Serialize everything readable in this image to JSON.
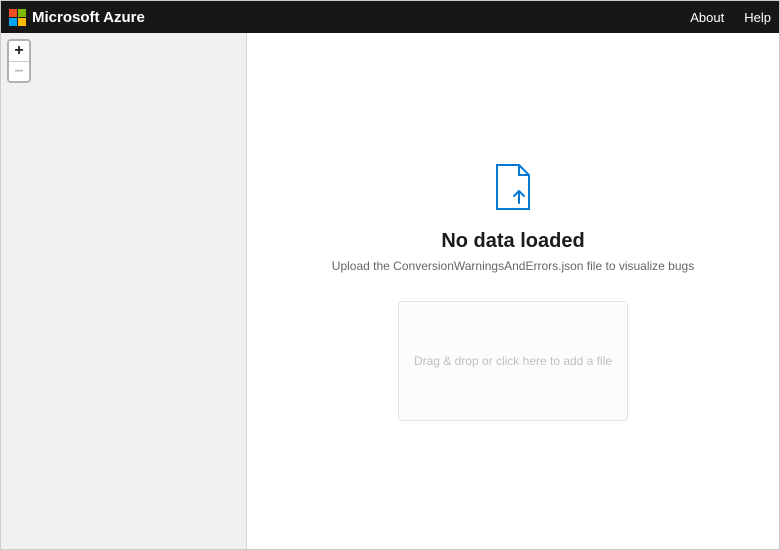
{
  "topbar": {
    "brand": "Microsoft Azure",
    "links": {
      "about": "About",
      "help": "Help"
    }
  },
  "sidebar": {
    "zoom": {
      "in": "+",
      "out": "−"
    }
  },
  "main": {
    "icon": "upload-document-icon",
    "empty_title": "No data loaded",
    "empty_subtitle": "Upload the ConversionWarningsAndErrors.json file to visualize bugs",
    "dropzone_text": "Drag & drop or click here to add a file"
  }
}
